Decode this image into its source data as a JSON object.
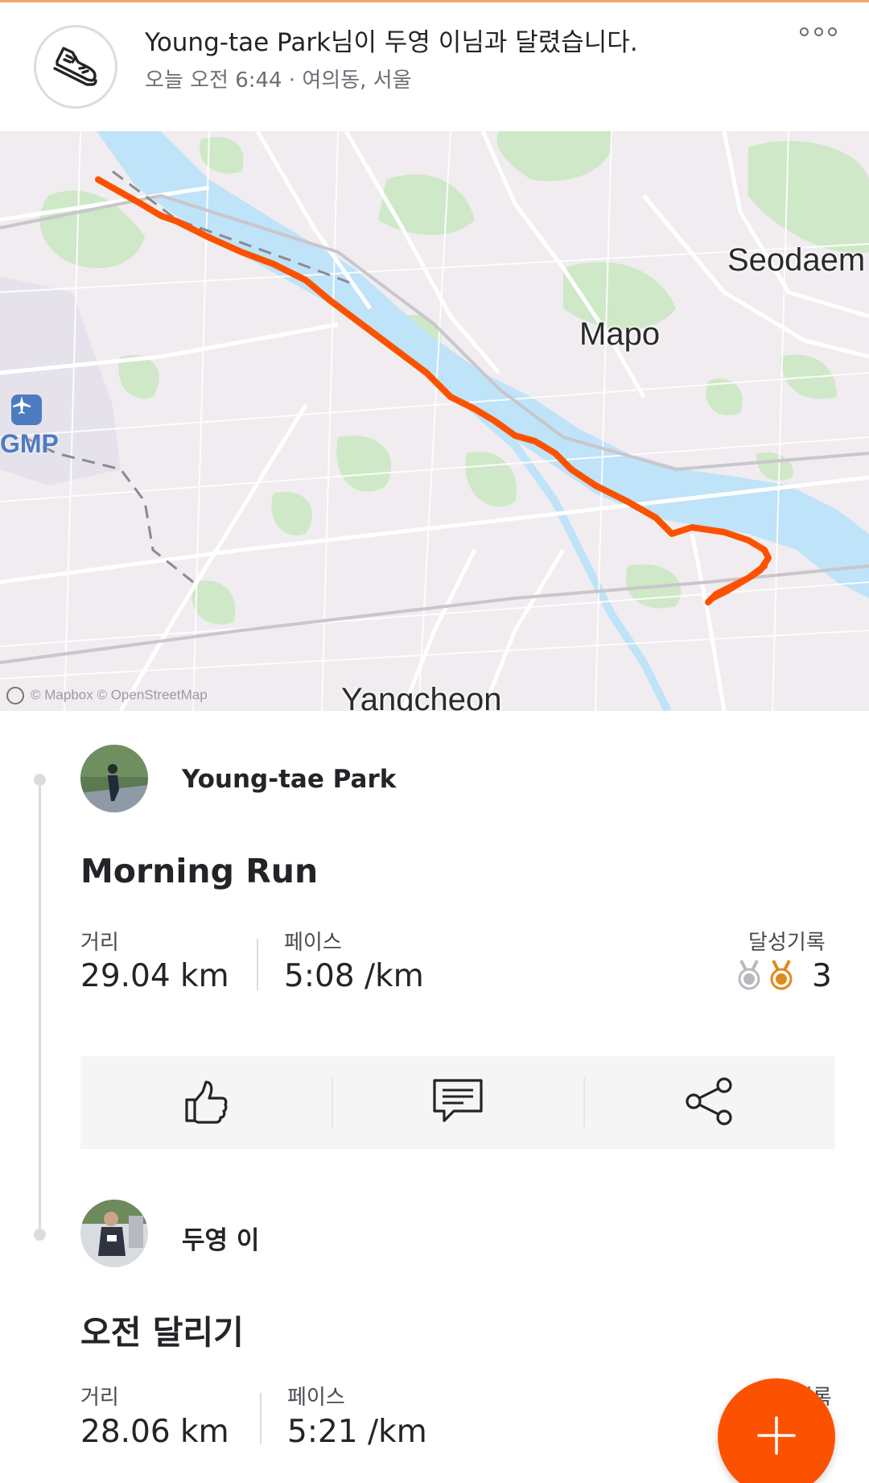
{
  "header": {
    "title": "Young-tae Park님이 두영 이님과 달렸습니다.",
    "subtitle": "오늘 오전 6:44 · 여의동, 서울",
    "icon": "shoe-icon",
    "more_icon": "more-options-icon"
  },
  "map": {
    "labels": {
      "seodaemun": "Seodaem",
      "mapo": "Mapo",
      "yangcheon": "Yangcheon",
      "gmp": "GMP"
    },
    "attribution": "© Mapbox © OpenStreetMap",
    "route_color": "#fc5200",
    "river_color": "#bfe3f8",
    "park_color": "#cfe8c7"
  },
  "activities": [
    {
      "athlete": "Young-tae Park",
      "title": "Morning Run",
      "distance_label": "거리",
      "distance_value": "29.04 km",
      "pace_label": "페이스",
      "pace_value": "5:08 /km",
      "achievements_label": "달성기록",
      "achievements_count": "3"
    },
    {
      "athlete": "두영 이",
      "title": "오전 달리기",
      "distance_label": "거리",
      "distance_value": "28.06 km",
      "pace_label": "페이스",
      "pace_value": "5:21 /km",
      "achievements_label": "기록"
    }
  ],
  "actions": {
    "kudos": "thumbs-up-icon",
    "comment": "comment-icon",
    "share": "share-icon"
  },
  "fab": {
    "icon": "plus-icon",
    "color": "#fc5200"
  }
}
